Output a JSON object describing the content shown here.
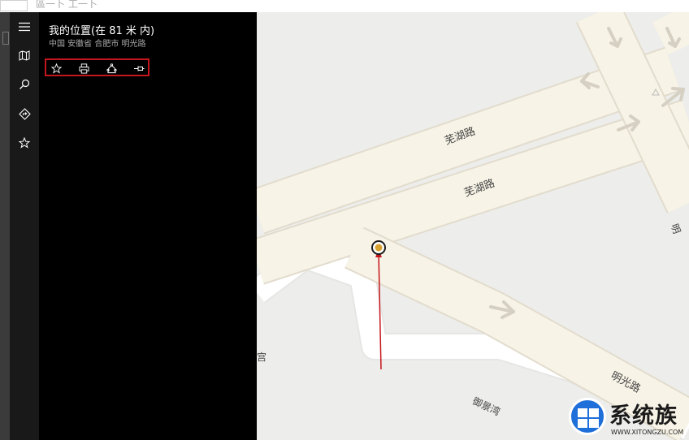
{
  "topbar": {
    "text": "區一卜  工一卜"
  },
  "nav": {
    "items": [
      "menu-icon",
      "map-icon",
      "search-icon",
      "directions-icon",
      "favorites-icon"
    ]
  },
  "location": {
    "title": "我的位置(在 81 米 内)",
    "address": "中国 安徽省 合肥市  明光路"
  },
  "actions": [
    "star-icon",
    "print-icon",
    "share-icon",
    "pin-icon"
  ],
  "map": {
    "roads": [
      "芜湖路",
      "芜湖路",
      "明光路",
      "御景湾",
      "宫",
      "明"
    ],
    "accent": "#c4161c"
  },
  "watermark": {
    "brand": "系统族",
    "url": "WWW.XITONGZU.COM"
  }
}
